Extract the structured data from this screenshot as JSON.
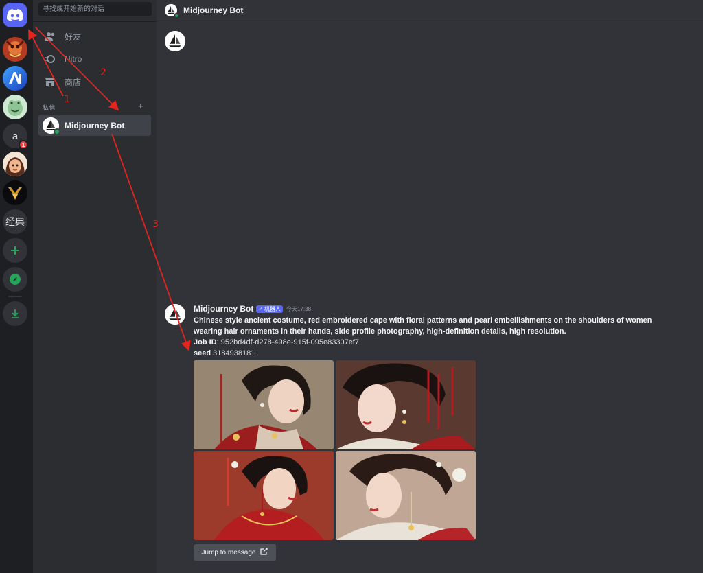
{
  "servers": {
    "home_name": "Discord",
    "letter_server": "a",
    "letter_badge": "1",
    "classic_label": "经典"
  },
  "sidebar": {
    "search_placeholder": "寻找或开始新的对话",
    "nav": [
      {
        "label": "好友",
        "icon": "friends-icon"
      },
      {
        "label": "Nitro",
        "icon": "nitro-icon"
      },
      {
        "label": "商店",
        "icon": "shop-icon"
      }
    ],
    "dm_header": "私信",
    "dm_add": "+",
    "dm_active": "Midjourney Bot"
  },
  "header": {
    "title": "Midjourney Bot"
  },
  "message": {
    "author": "Midjourney Bot",
    "tag_check": "✓",
    "tag": "机器人",
    "time": "今天17:38",
    "prompt": "Chinese style ancient costume, red embroidered cape with floral patterns and pearl embellishments on the shoulders of women wearing hair ornaments in their hands, side profile photography, high-definition details, high resolution.",
    "job_label": "Job ID",
    "job_sep": ":",
    "job_id": "952bd4df-d278-498e-915f-095e83307ef7",
    "seed_label": "seed",
    "seed": "3184938181",
    "jump_label": "Jump to message"
  },
  "annotations": [
    "1",
    "2",
    "3"
  ],
  "colors": {
    "accent": "#5865f2",
    "online": "#23a55a",
    "annotation": "#e52420"
  }
}
